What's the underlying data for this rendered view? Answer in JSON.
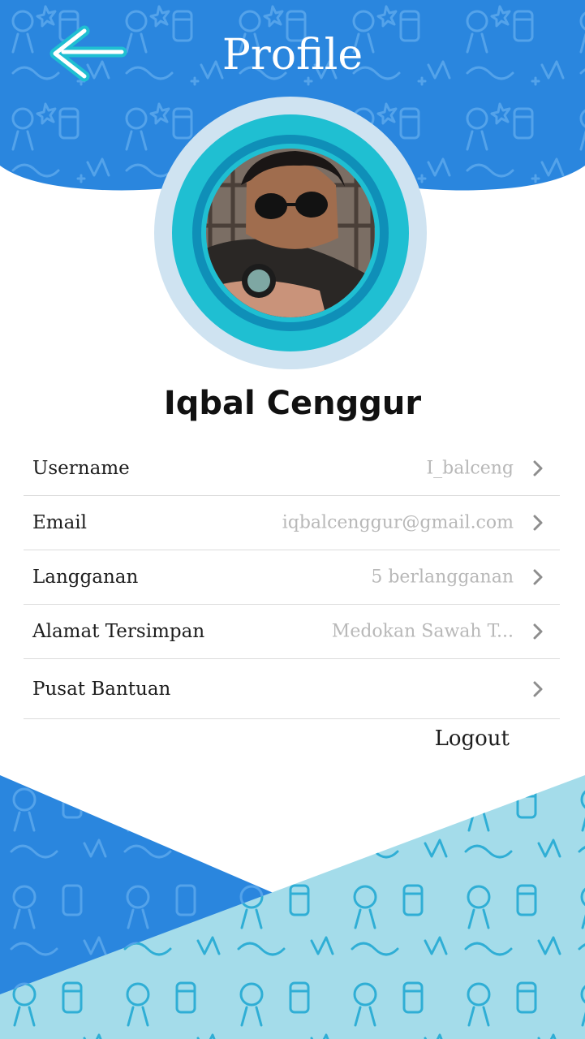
{
  "header": {
    "title": "Profile",
    "back_icon": "arrow-left-icon",
    "background_color": "#2A86DE",
    "pattern": "food-doodle-pattern"
  },
  "profile": {
    "name": "Iqbal Cenggur",
    "avatar": "user-avatar-photo",
    "ring_colors": [
      "#CFE3F1",
      "#1FBFD2",
      "#0F8FB8"
    ]
  },
  "menu": [
    {
      "label": "Username",
      "value": "I_balceng",
      "icon": "chevron-right-icon"
    },
    {
      "label": "Email",
      "value": "iqbalcenggur@gmail.com",
      "icon": "chevron-right-icon"
    },
    {
      "label": "Langganan",
      "value": "5 berlangganan",
      "icon": "chevron-right-icon"
    },
    {
      "label": "Alamat Tersimpan",
      "value": "Medokan Sawah T...",
      "icon": "chevron-right-icon"
    },
    {
      "label": "Pusat Bantuan",
      "value": "",
      "icon": "chevron-right-icon"
    }
  ],
  "logout_label": "Logout",
  "footer": {
    "left_color": "#2A86DE",
    "right_color": "#A4DCEA",
    "pattern": "food-doodle-pattern"
  }
}
